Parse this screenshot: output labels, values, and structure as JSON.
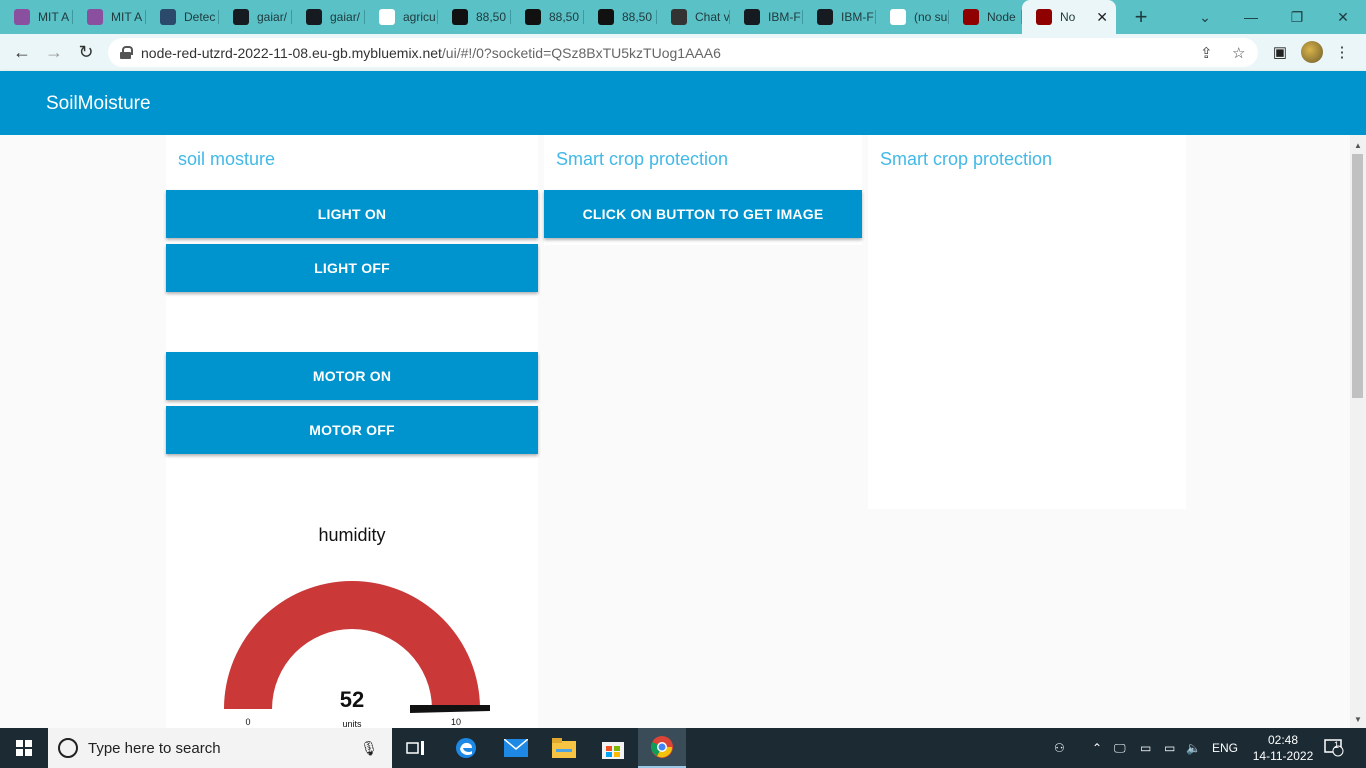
{
  "browser": {
    "tabs": [
      {
        "title": "MIT A",
        "icon": "mit-app-inventor-icon",
        "color": "#8a4f9e"
      },
      {
        "title": "MIT A",
        "icon": "mit-app-inventor-icon",
        "color": "#8a4f9e"
      },
      {
        "title": "Detec",
        "icon": "tds-icon",
        "color": "#2b4a6b"
      },
      {
        "title": "gaiar/",
        "icon": "github-icon",
        "color": "#161b22"
      },
      {
        "title": "gaiar/",
        "icon": "github-icon",
        "color": "#161b22"
      },
      {
        "title": "agricu",
        "icon": "google-icon",
        "color": "#ffffff"
      },
      {
        "title": "88,50",
        "icon": "is-icon",
        "color": "#111111"
      },
      {
        "title": "88,50",
        "icon": "is-icon",
        "color": "#111111"
      },
      {
        "title": "88,50",
        "icon": "is-icon",
        "color": "#111111"
      },
      {
        "title": "Chat v",
        "icon": "chat-globe-icon",
        "color": "#333333"
      },
      {
        "title": "IBM-F",
        "icon": "github-icon",
        "color": "#161b22"
      },
      {
        "title": "IBM-F",
        "icon": "github-icon",
        "color": "#161b22"
      },
      {
        "title": "(no su",
        "icon": "gmail-icon",
        "color": "#ffffff"
      },
      {
        "title": "Node",
        "icon": "node-red-icon",
        "color": "#8f0000"
      },
      {
        "title": "No",
        "icon": "node-red-icon",
        "color": "#8f0000",
        "active": true
      }
    ],
    "url_host": "node-red-utzrd-2022-11-08.eu-gb.mybluemix.net",
    "url_path": "/ui/#!/0?socketid=QSz8BxTU5kzTUog1AAA6"
  },
  "dashboard": {
    "title": "SoilMoisture",
    "accent": "#0094ce",
    "group_title_color": "#42b9e6",
    "groups": {
      "left": {
        "title": "soil mosture",
        "buttons": {
          "light_on": "LIGHT ON",
          "light_off": "LIGHT OFF",
          "motor_on": "MOTOR ON",
          "motor_off": "MOTOR OFF"
        },
        "gauge": {
          "title": "humidity",
          "value": "52",
          "units": "units",
          "min": "0",
          "max": "10",
          "fraction": 1.0,
          "fill_color": "#ca3838"
        }
      },
      "middle": {
        "title": "Smart crop protection",
        "button": "CLICK ON BUTTON TO GET IMAGE"
      },
      "right": {
        "title": "Smart crop protection"
      }
    }
  },
  "taskbar": {
    "search_placeholder": "Type here to search",
    "lang": "ENG",
    "time": "02:48",
    "date": "14-11-2022",
    "notifications": "1"
  }
}
